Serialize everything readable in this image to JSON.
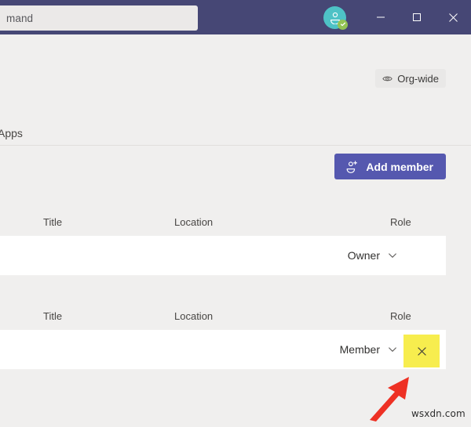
{
  "titlebar": {
    "search": {
      "placeholder": "mand",
      "icon": "search-icon"
    },
    "avatar": {
      "icon": "person-avatar-icon",
      "presence": "available-check-icon"
    },
    "window_controls": [
      {
        "name": "minimize",
        "glyph": "—"
      },
      {
        "name": "maximize",
        "glyph": "□"
      },
      {
        "name": "close",
        "glyph": "✕"
      }
    ],
    "colors": {
      "bar_background": "#464775",
      "search_background": "#ebe9e8"
    }
  },
  "header": {
    "org_badge": {
      "label": "Org-wide",
      "icon": "eye-icon"
    }
  },
  "tabs": [
    {
      "label": "Apps",
      "selected": false
    }
  ],
  "toolbar": {
    "add_member_label": "Add member",
    "add_member_icon": "person-add-icon",
    "accent_color": "#5558af"
  },
  "tables": [
    {
      "id": "owners",
      "columns": [
        "Title",
        "Location",
        "Role"
      ],
      "rows": [
        {
          "title": "",
          "location": "",
          "role": "Owner",
          "role_chevron": "chevron-down-icon",
          "has_remove": false
        }
      ]
    },
    {
      "id": "members",
      "columns": [
        "Title",
        "Location",
        "Role"
      ],
      "rows": [
        {
          "title": "",
          "location": "",
          "role": "Member",
          "role_chevron": "chevron-down-icon",
          "has_remove": true,
          "remove_icon": "close-icon",
          "remove_highlight_color": "#f7ed4e"
        }
      ]
    }
  ],
  "annotation": {
    "arrow": {
      "color": "#ee3124",
      "direction": "up-right",
      "points_at": "remove-member-button"
    },
    "watermark": "wsxdn.com"
  }
}
